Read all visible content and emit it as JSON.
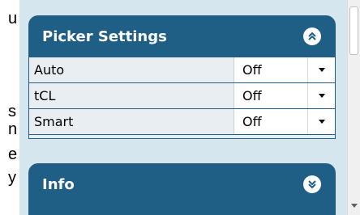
{
  "left_text": [
    {
      "text": "u"
    },
    {
      "text": "s"
    },
    {
      "text": "n"
    },
    {
      "text": "e"
    },
    {
      "text": "y"
    }
  ],
  "picker_settings": {
    "title": "Picker Settings",
    "toggle_icon": "collapse-double-chevron-up-icon",
    "rows": [
      {
        "label": "Auto",
        "value": "Off"
      },
      {
        "label": "tCL",
        "value": "Off"
      },
      {
        "label": "Smart",
        "value": "Off"
      }
    ]
  },
  "info": {
    "title": "Info",
    "toggle_icon": "expand-double-chevron-down-icon"
  },
  "colors": {
    "panel_header": "#1f5f85",
    "panel_bg": "#d6e6ee",
    "row_label_bg": "#e8eef2"
  }
}
